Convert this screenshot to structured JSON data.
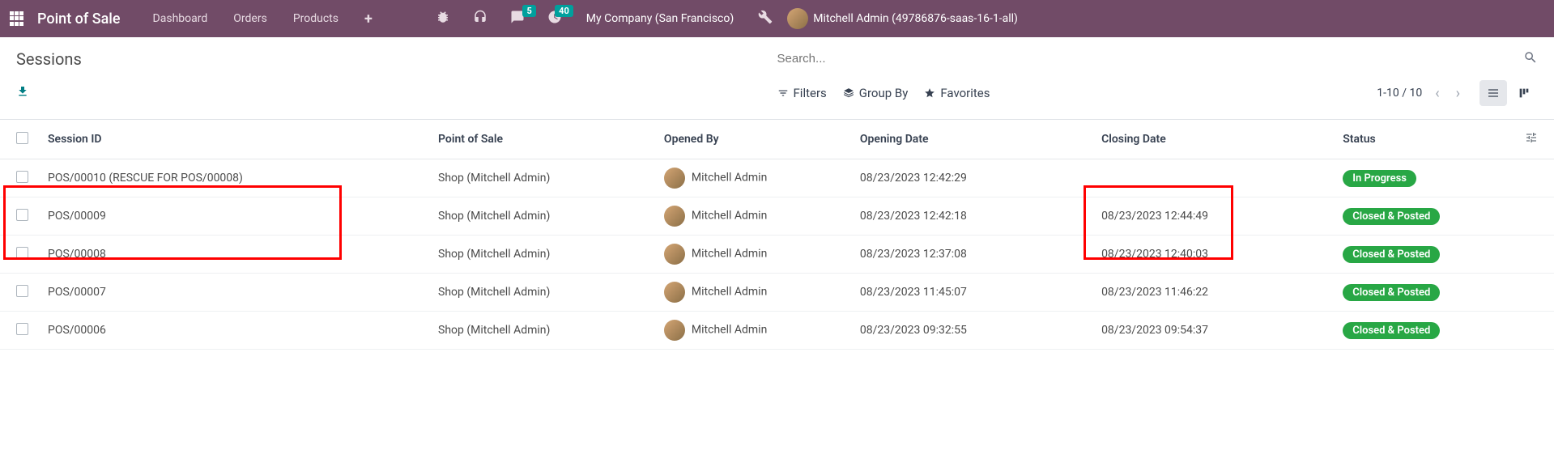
{
  "topbar": {
    "app_name": "Point of Sale",
    "nav": [
      "Dashboard",
      "Orders",
      "Products"
    ],
    "messages_badge": "5",
    "activities_badge": "40",
    "company": "My Company (San Francisco)",
    "user": "Mitchell Admin (49786876-saas-16-1-all)"
  },
  "cp": {
    "title": "Sessions",
    "search_placeholder": "Search...",
    "filters": "Filters",
    "group_by": "Group By",
    "favorites": "Favorites",
    "pager": "1-10 / 10"
  },
  "table": {
    "headers": {
      "session_id": "Session ID",
      "pos": "Point of Sale",
      "opened_by": "Opened By",
      "opening_date": "Opening Date",
      "closing_date": "Closing Date",
      "status": "Status"
    },
    "rows": [
      {
        "sid": "POS/00010 (RESCUE FOR POS/00008)",
        "pos": "Shop (Mitchell Admin)",
        "ob": "Mitchell Admin",
        "od": "08/23/2023 12:42:29",
        "cd": "",
        "st": "In Progress"
      },
      {
        "sid": "POS/00009",
        "pos": "Shop (Mitchell Admin)",
        "ob": "Mitchell Admin",
        "od": "08/23/2023 12:42:18",
        "cd": "08/23/2023 12:44:49",
        "st": "Closed & Posted"
      },
      {
        "sid": "POS/00008",
        "pos": "Shop (Mitchell Admin)",
        "ob": "Mitchell Admin",
        "od": "08/23/2023 12:37:08",
        "cd": "08/23/2023 12:40:03",
        "st": "Closed & Posted"
      },
      {
        "sid": "POS/00007",
        "pos": "Shop (Mitchell Admin)",
        "ob": "Mitchell Admin",
        "od": "08/23/2023 11:45:07",
        "cd": "08/23/2023 11:46:22",
        "st": "Closed & Posted"
      },
      {
        "sid": "POS/00006",
        "pos": "Shop (Mitchell Admin)",
        "ob": "Mitchell Admin",
        "od": "08/23/2023 09:32:55",
        "cd": "08/23/2023 09:54:37",
        "st": "Closed & Posted"
      }
    ]
  }
}
